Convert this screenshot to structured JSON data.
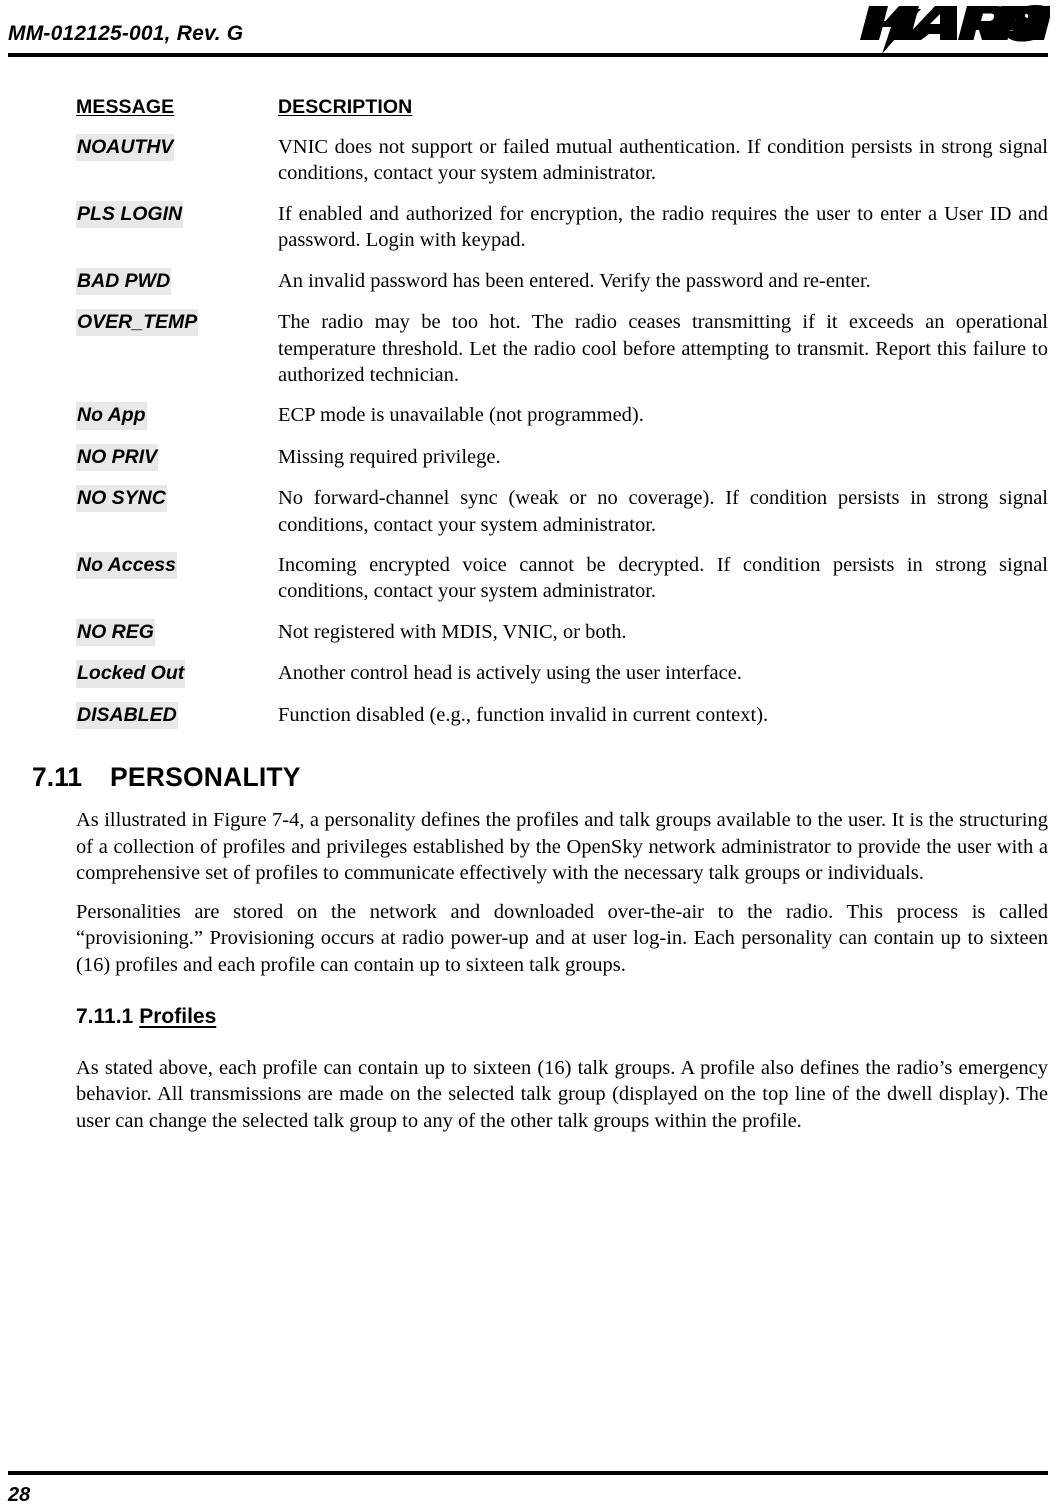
{
  "header": {
    "document_id": "MM-012125-001, Rev. G",
    "logo_text": "HARRIS",
    "logo_registered_mark": "®"
  },
  "table": {
    "headers": {
      "message": "MESSAGE",
      "description": "DESCRIPTION"
    },
    "rows": [
      {
        "message": "NOAUTHV",
        "description": "VNIC does not support or failed mutual authentication. If condition persists in strong signal conditions, contact your system administrator."
      },
      {
        "message": "PLS LOGIN",
        "description": "If enabled and authorized for encryption, the radio requires the user to enter a User ID and password. Login with keypad."
      },
      {
        "message": "BAD PWD",
        "description": "An invalid password has been entered. Verify the password and re-enter."
      },
      {
        "message": "OVER_TEMP",
        "description": "The radio may be too hot. The radio ceases transmitting if it exceeds an operational temperature threshold. Let the radio cool before attempting to transmit. Report this failure to authorized technician."
      },
      {
        "message": "No App",
        "description": "ECP mode is unavailable (not programmed)."
      },
      {
        "message": "NO PRIV",
        "description": "Missing required privilege."
      },
      {
        "message": "NO SYNC",
        "description": "No forward-channel sync (weak or no coverage). If condition persists in strong signal conditions, contact your system administrator."
      },
      {
        "message": "No Access",
        "description": "Incoming encrypted voice cannot be decrypted. If condition persists in strong signal conditions, contact your system administrator."
      },
      {
        "message": "NO REG",
        "description": "Not registered with MDIS, VNIC, or both."
      },
      {
        "message": "Locked Out",
        "description": "Another control head is actively using the user interface."
      },
      {
        "message": "DISABLED",
        "description": "Function disabled (e.g., function invalid in current context)."
      }
    ]
  },
  "section": {
    "number": "7.11",
    "title": "PERSONALITY",
    "paragraphs": [
      "As illustrated in Figure 7-4, a personality defines the profiles and talk groups available to the user. It is the structuring of a collection of profiles and privileges established by the OpenSky network administrator to provide the user with a comprehensive set of profiles to communicate effectively with the necessary talk groups or individuals.",
      "Personalities are stored on the network and downloaded over-the-air to the radio. This process is called “provisioning.” Provisioning occurs at radio power-up and at user log-in. Each personality can contain up to sixteen (16) profiles and each profile can contain up to sixteen talk groups."
    ]
  },
  "subsection": {
    "number": "7.11.1",
    "title": "Profiles",
    "paragraphs": [
      "As stated above, each profile can contain up to sixteen (16) talk groups. A profile also defines the radio’s emergency behavior. All transmissions are made on the selected talk group (displayed on the top line of the dwell display). The user can change the selected talk group to any of the other talk groups within the profile."
    ]
  },
  "footer": {
    "page_number": "28"
  },
  "colors": {
    "highlight": "#e8e8e8",
    "text": "#000000",
    "rule": "#000000"
  }
}
